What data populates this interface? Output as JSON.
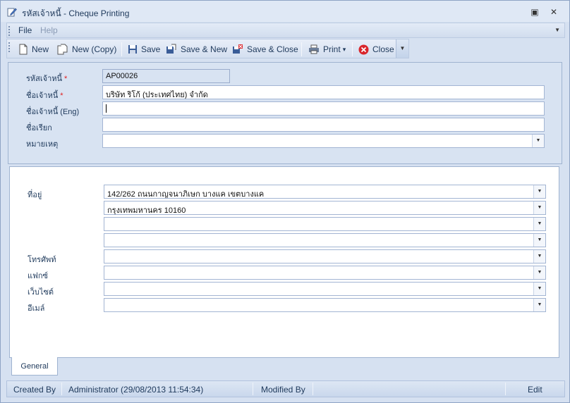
{
  "window": {
    "title": "รหัสเจ้าหนี้ - Cheque Printing",
    "restore_glyph": "▣",
    "close_glyph": "✕"
  },
  "menu": {
    "items": [
      {
        "label": "File"
      },
      {
        "label": "Help"
      }
    ],
    "overflow_glyph": "▼"
  },
  "toolbar": {
    "new_label": "New",
    "new_copy_label": "New (Copy)",
    "save_label": "Save",
    "save_new_label": "Save & New",
    "save_close_label": "Save & Close",
    "print_label": "Print",
    "close_label": "Close",
    "print_dropdown_glyph": "▾",
    "overflow_glyph": "▼"
  },
  "header_form": {
    "code_label": "รหัสเจ้าหนี้",
    "code_value": "AP00026",
    "name_label": "ชื่อเจ้าหนี้",
    "name_value": "บริษัท ริโก้ (ประเทศไทย) จำกัด",
    "name_eng_label": "ชื่อเจ้าหนี้ (Eng)",
    "name_eng_value": "",
    "alias_label": "ชื่อเรียก",
    "alias_value": "",
    "remark_label": "หมายเหตุ",
    "remark_value": "",
    "required_mark": "*"
  },
  "general_tab": {
    "address_label": "ที่อยู่",
    "address_lines": [
      "142/262 ถนนกาญจนาภิเษก บางแค เขตบางแค",
      "กรุงเทพมหานคร 10160",
      "",
      ""
    ],
    "phone_label": "โทรศัพท์",
    "phone_value": "",
    "fax_label": "แฟกซ์",
    "fax_value": "",
    "website_label": "เว็บไซต์",
    "website_value": "",
    "email_label": "อีเมล์",
    "email_value": "",
    "dropdown_glyph": "▼"
  },
  "tabs": [
    {
      "label": "General",
      "active": true
    }
  ],
  "statusbar": {
    "created_by_label": "Created By",
    "created_by_value": "Administrator (29/08/2013 11:54:34)",
    "modified_by_label": "Modified By",
    "modified_by_value": "",
    "mode": "Edit"
  },
  "colors": {
    "accent": "#1e395b",
    "required": "#e02020",
    "close_icon": "#d9262c"
  }
}
